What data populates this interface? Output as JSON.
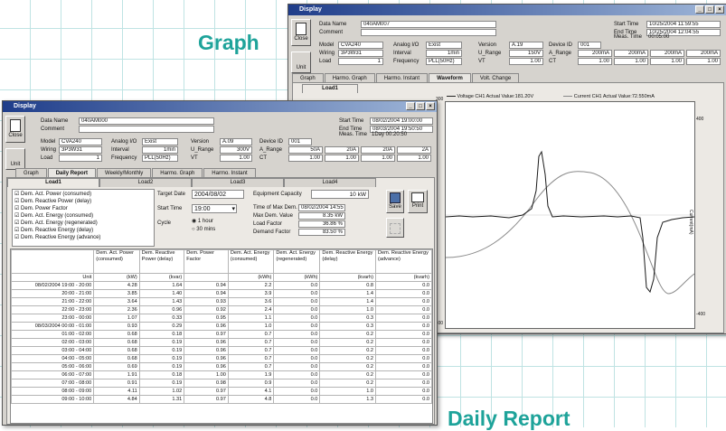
{
  "captions": {
    "graph": "Graph",
    "daily": "Daily Report"
  },
  "colors": {
    "accent": "#1ea39a",
    "titlebar": "#1f3d8a"
  },
  "graph_window": {
    "title": "Display",
    "close_label": "Close",
    "unit_label": "Unit",
    "data_name_label": "Data Name",
    "data_name": "040AM007",
    "comment_label": "Comment",
    "model_label": "Model",
    "model": "CVA240",
    "wiring_label": "Wiring",
    "wiring": "3P3W31",
    "load_label": "Load",
    "load": "1",
    "analog_label": "Analog I/O",
    "analog": "Exist",
    "interval_label": "Interval",
    "interval": "1min",
    "freq_label": "Frequency",
    "freq": "PLL(50Hz)",
    "version_label": "Version",
    "version": "A.19",
    "urange_label": "U_Range",
    "urange": "150V",
    "vt_label": "VT",
    "vt": "1.00",
    "device_label": "Device ID",
    "device": "001",
    "arange_label": "A_Range",
    "arange": [
      "200mA",
      "200mA",
      "200mA",
      "200mA"
    ],
    "ct_label": "CT",
    "ct": [
      "1.00",
      "1.00",
      "1.00",
      "1.00"
    ],
    "start_label": "Start Time",
    "start": "10/25/2004 11:59:55",
    "end_label": "End Time",
    "end": "10/25/2004 12:04:55",
    "meas_label": "Meas. Time",
    "meas": "00:05:00",
    "tabs": [
      "Graph",
      "Harmo. Graph",
      "Harmo. Instant",
      "Waveform",
      "Volt. Change"
    ],
    "active_tab": "Waveform",
    "subtab": "Load1",
    "legend_v": "Voltage CH1  Actual Value:181.20V",
    "legend_c": "Current CH1  Actual Value:72.550mA",
    "y_left_top": "300",
    "y_left_bottom": "-300",
    "y_right_top": "400",
    "y_right_bottom": "-400",
    "y_right_label": "Current(mA)"
  },
  "daily_window": {
    "title": "Display",
    "close_label": "Close",
    "unit_label": "Unit",
    "data_name_label": "Data Name",
    "data_name": "040AM000",
    "comment_label": "Comment",
    "model_label": "Model",
    "model": "CVA240",
    "wiring_label": "Wiring",
    "wiring": "3P3W31",
    "load_label": "Load",
    "load": "1",
    "analog_label": "Analog I/O",
    "analog": "Exist",
    "interval_label": "Interval",
    "interval": "1min",
    "freq_label": "Frequency",
    "freq": "PLL(50Hz)",
    "version_label": "Version",
    "version": "A.09",
    "urange_label": "U_Range",
    "urange": "300V",
    "vt_label": "VT",
    "vt": "1.00",
    "device_label": "Device ID",
    "device": "001",
    "arange_label": "A_Range",
    "arange": [
      "50A",
      "20A",
      "20A",
      "2A"
    ],
    "ct_label": "CT",
    "ct": [
      "1.00",
      "1.00",
      "1.00",
      "1.00"
    ],
    "start_label": "Start Time",
    "start": "08/02/2004 19:00:00",
    "end_label": "End Time",
    "end": "08/03/2004 19:50:50",
    "meas_label": "Meas. Time",
    "meas": "1Day 00:20:50",
    "tabs": [
      "Graph",
      "Daily Report",
      "Weekly/Monthly",
      "Harmo. Graph",
      "Harmo. Instant"
    ],
    "active_tab": "Daily Report",
    "subtabs": [
      "Load1",
      "Load2",
      "Load3",
      "Load4"
    ],
    "checklist": [
      "Dem. Act. Power (consumed)",
      "Dem. Reactive Power (delay)",
      "Dem. Power Factor",
      "Dem. Act. Energy (consumed)",
      "Dem. Act. Energy (regenerated)",
      "Dem. Reactive Energy (delay)",
      "Dem. Reactive Energy (advance)"
    ],
    "target_label": "Target Date",
    "target": "2004/08/02",
    "starttime_label": "Start Time",
    "starttime": "19:00",
    "cycle_label": "Cycle",
    "cycle_opt1": "1 hour",
    "cycle_opt2": "30 mins",
    "equip_label": "Equipment Capacity",
    "equip": "10",
    "equip_unit": "kW",
    "maxtime_label": "Time of Max Dem.",
    "maxtime": "08/02/2004 14:55",
    "maxval_label": "Max Dem. Value",
    "maxval": "8.35",
    "maxval_unit": "kW",
    "loadf_label": "Load Factor",
    "loadf": "36.86",
    "loadf_unit": "%",
    "demf_label": "Demand Factor",
    "demf": "83.50",
    "demf_unit": "%",
    "save_label": "Save",
    "print_label": "Print",
    "headers": [
      "",
      "Dem. Act. Power (consumed)",
      "Dem. Reactive Power (delay)",
      "Dem. Power Factor",
      "Dem. Act. Energy (consumed)",
      "Dem. Act. Energy (regenerated)",
      "Dem. Reactive Energy (delay)",
      "Dem. Reactive Energy (advance)"
    ],
    "units": [
      "Unit",
      "(kW)",
      "(kvar)",
      "",
      "(kWh)",
      "(kWh)",
      "(kvarh)",
      "(kvarh)"
    ],
    "rows": [
      [
        "08/02/2004 19:00 - 20:00",
        "4.28",
        "1.64",
        "0.94",
        "2.2",
        "0.0",
        "0.8",
        "0.0"
      ],
      [
        "20:00 - 21:00",
        "3.85",
        "1.40",
        "0.94",
        "3.9",
        "0.0",
        "1.4",
        "0.0"
      ],
      [
        "21:00 - 22:00",
        "3.64",
        "1.43",
        "0.93",
        "3.6",
        "0.0",
        "1.4",
        "0.0"
      ],
      [
        "22:00 - 23:00",
        "2.36",
        "0.96",
        "0.92",
        "2.4",
        "0.0",
        "1.0",
        "0.0"
      ],
      [
        "23:00 - 00:00",
        "1.07",
        "0.33",
        "0.95",
        "1.1",
        "0.0",
        "0.3",
        "0.0"
      ],
      [
        "08/03/2004 00:00 - 01:00",
        "0.93",
        "0.29",
        "0.96",
        "1.0",
        "0.0",
        "0.3",
        "0.0"
      ],
      [
        "01:00 - 02:00",
        "0.68",
        "0.18",
        "0.97",
        "0.7",
        "0.0",
        "0.2",
        "0.0"
      ],
      [
        "02:00 - 03:00",
        "0.68",
        "0.19",
        "0.96",
        "0.7",
        "0.0",
        "0.2",
        "0.0"
      ],
      [
        "03:00 - 04:00",
        "0.68",
        "0.19",
        "0.96",
        "0.7",
        "0.0",
        "0.2",
        "0.0"
      ],
      [
        "04:00 - 05:00",
        "0.68",
        "0.19",
        "0.96",
        "0.7",
        "0.0",
        "0.2",
        "0.0"
      ],
      [
        "05:00 - 06:00",
        "0.69",
        "0.19",
        "0.96",
        "0.7",
        "0.0",
        "0.2",
        "0.0"
      ],
      [
        "06:00 - 07:00",
        "1.91",
        "0.18",
        "1.00",
        "1.9",
        "0.0",
        "0.2",
        "0.0"
      ],
      [
        "07:00 - 08:00",
        "0.91",
        "0.19",
        "0.98",
        "0.9",
        "0.0",
        "0.2",
        "0.0"
      ],
      [
        "08:00 - 09:00",
        "4.11",
        "1.02",
        "0.97",
        "4.1",
        "0.0",
        "1.0",
        "0.0"
      ],
      [
        "09:00 - 10:00",
        "4.84",
        "1.31",
        "0.97",
        "4.8",
        "0.0",
        "1.3",
        "0.0"
      ]
    ]
  }
}
